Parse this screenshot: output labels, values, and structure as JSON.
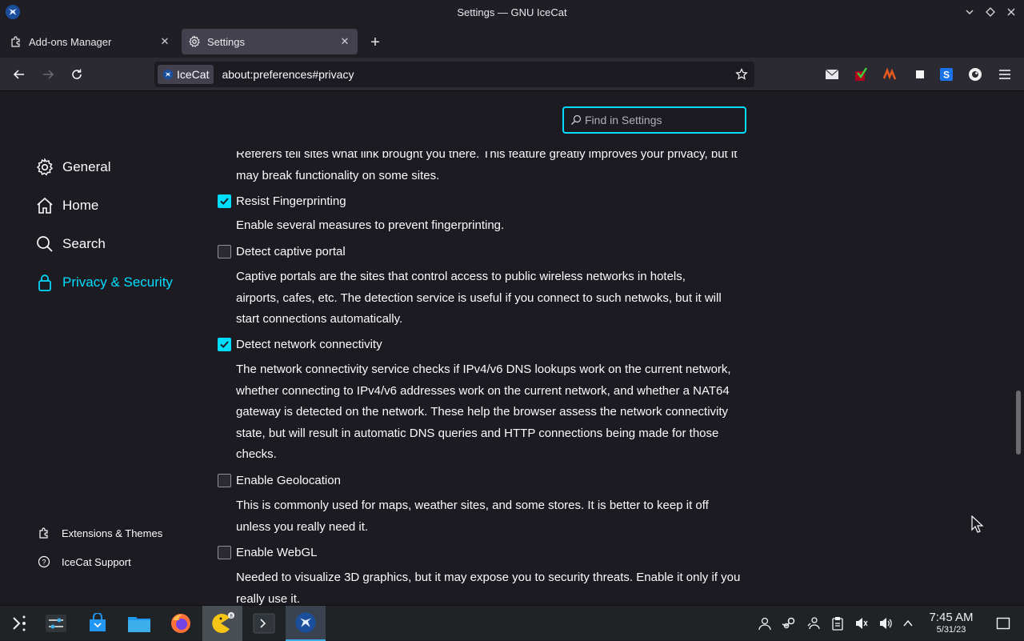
{
  "window": {
    "title": "Settings — GNU IceCat"
  },
  "tabs": [
    {
      "label": "Add-ons Manager"
    },
    {
      "label": "Settings"
    }
  ],
  "urlbar": {
    "identity_label": "IceCat",
    "url": "about:preferences#privacy"
  },
  "search": {
    "placeholder": "Find in Settings"
  },
  "sidebar": {
    "categories": [
      {
        "label": "General"
      },
      {
        "label": "Home"
      },
      {
        "label": "Search"
      },
      {
        "label": "Privacy & Security"
      }
    ],
    "footer": [
      {
        "label": "Extensions & Themes"
      },
      {
        "label": "IceCat Support"
      }
    ]
  },
  "settings": {
    "partial_top": {
      "desc": "Referers tell sites what link brought you there. This feature greatly improves your privacy, but it may break functionality on some sites."
    },
    "options": [
      {
        "label": "Resist Fingerprinting",
        "checked": true,
        "desc": "Enable several measures to prevent fingerprinting."
      },
      {
        "label": "Detect captive portal",
        "checked": false,
        "desc": "Captive portals are the sites that control access to public wireless networks in hotels, airports, cafes, etc. The detection service is useful if you connect to such netwoks, but it will start connections automatically."
      },
      {
        "label": "Detect network connectivity",
        "checked": true,
        "desc": "The network connectivity service checks if IPv4/v6 DNS lookups work on the current network, whether connecting to IPv4/v6 addresses work on the current network, and whether a NAT64 gateway is detected on the network. These help the browser assess the network connectivity state, but will result in automatic DNS queries and HTTP connections being made for those checks."
      },
      {
        "label": "Enable Geolocation",
        "checked": false,
        "desc": "This is commonly used for maps, weather sites, and some stores. It is better to keep it off unless you really need it."
      },
      {
        "label": "Enable WebGL",
        "checked": false,
        "desc": "Needed to visualize 3D graphics, but it may expose you to security threats. Enable it only if you really use it."
      }
    ]
  },
  "taskbar": {
    "clock_time": "7:45 AM",
    "clock_date": "5/31/23"
  },
  "colors": {
    "accent": "#00ddff",
    "background": "#1c1b22",
    "toolbar": "#2b2a33"
  }
}
